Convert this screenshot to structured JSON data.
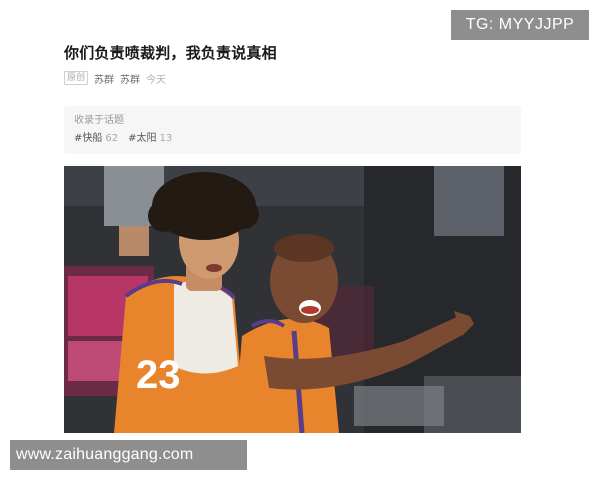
{
  "watermarks": {
    "top_right": "TG: MYYJJPP",
    "bottom_left": "www.zaihuanggang.com"
  },
  "article": {
    "title": "你们负责喷裁判，我负责说真相",
    "meta": {
      "original_tag": "原创",
      "author": "苏群",
      "account": "苏群",
      "time": "今天"
    },
    "topics": {
      "label": "收录于话题",
      "items": [
        {
          "name": "#快船",
          "count": "62"
        },
        {
          "name": "#太阳",
          "count": "13"
        }
      ]
    },
    "image": {
      "jersey_number": "23"
    }
  },
  "colors": {
    "background": "#ffffff",
    "watermark_bg": "#8e8e8e",
    "topic_box_bg": "#f6f6f6",
    "jersey_orange": "#e8842c",
    "jersey_purple": "#5a3d8a"
  }
}
